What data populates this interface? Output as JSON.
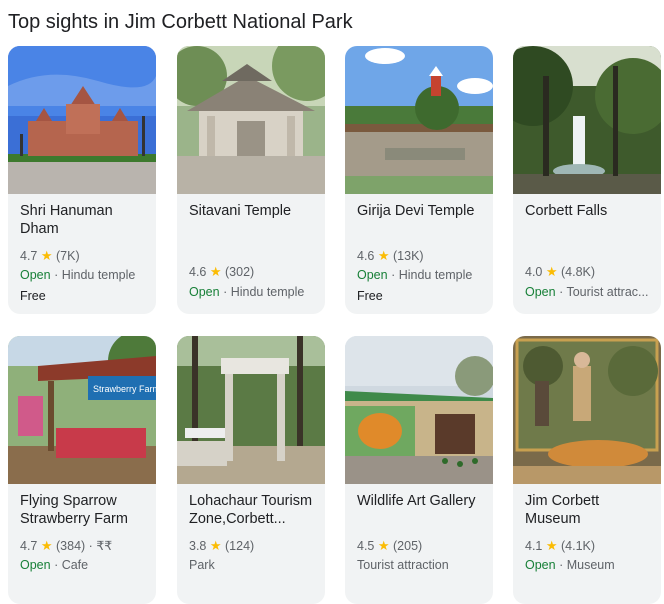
{
  "title": "Top sights in Jim Corbett National Park",
  "sights": [
    {
      "name": "Shri Hanuman Dham",
      "rating": "4.7",
      "reviews": "(7K)",
      "status": "Open",
      "category": "Hindu temple",
      "extra": "Free"
    },
    {
      "name": "Sitavani Temple",
      "rating": "4.6",
      "reviews": "(302)",
      "status": "Open",
      "category": "Hindu temple",
      "extra": ""
    },
    {
      "name": "Girija Devi Temple",
      "rating": "4.6",
      "reviews": "(13K)",
      "status": "Open",
      "category": "Hindu temple",
      "extra": "Free"
    },
    {
      "name": "Corbett Falls",
      "rating": "4.0",
      "reviews": "(4.8K)",
      "status": "Open",
      "category": "Tourist attrac...",
      "extra": ""
    },
    {
      "name": "Flying Sparrow Strawberry Farm",
      "rating": "4.7",
      "reviews": "(384)",
      "price": "₹₹",
      "status": "Open",
      "category": "Cafe",
      "extra": ""
    },
    {
      "name": "Lohachaur Tourism Zone,Corbett...",
      "rating": "3.8",
      "reviews": "(124)",
      "status": "",
      "category": "Park",
      "extra": ""
    },
    {
      "name": "Wildlife Art Gallery",
      "rating": "4.5",
      "reviews": "(205)",
      "status": "",
      "category": "Tourist attraction",
      "extra": ""
    },
    {
      "name": "Jim Corbett Museum",
      "rating": "4.1",
      "reviews": "(4.1K)",
      "status": "Open",
      "category": "Museum",
      "extra": ""
    }
  ],
  "sign_texts": {
    "strawberry": "Strawberry Farm"
  },
  "icons": {
    "star": "star-icon"
  },
  "colors": {
    "open": "#188038",
    "star": "#fbbc04",
    "card_bg": "#f1f3f4"
  }
}
